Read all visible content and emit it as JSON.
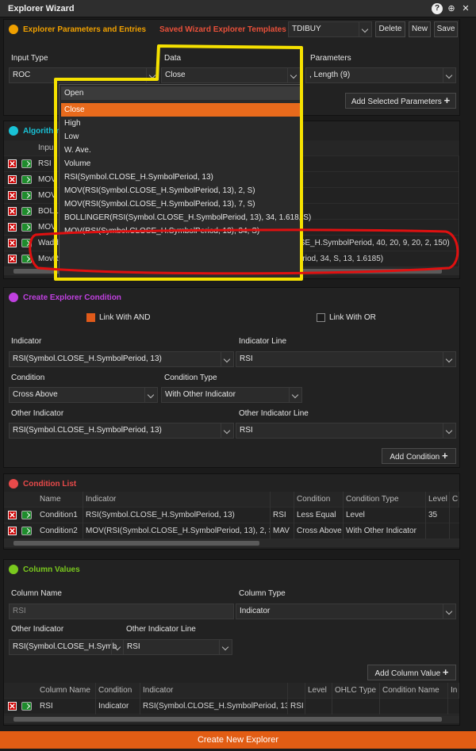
{
  "window": {
    "title": "Explorer Wizard",
    "help": "?",
    "pin": "⊕",
    "close": "✕"
  },
  "params": {
    "title": "Explorer Parameters and Entries",
    "templates_label": "Saved Wizard Explorer Templates",
    "template_value": "TDIBUY",
    "delete": "Delete",
    "new": "New",
    "save": "Save",
    "input_type_label": "Input Type",
    "input_type_value": "ROC",
    "data_label": "Data",
    "data_value": "Close",
    "parameters_label": "Parameters",
    "parameters_value": ", Length (9)",
    "add_selected": "Add Selected Parameters",
    "dropdown_items": [
      "Open",
      "Close",
      "High",
      "Low",
      "W. Ave.",
      "Volume",
      "RSI(Symbol.CLOSE_H.SymbolPeriod, 13)",
      "MOV(RSI(Symbol.CLOSE_H.SymbolPeriod, 13), 2, S)",
      "MOV(RSI(Symbol.CLOSE_H.SymbolPeriod, 13), 7, S)",
      "BOLLINGER(RSI(Symbol.CLOSE_H.SymbolPeriod, 13), 34, 1.618, S)",
      "MOV(RSI(Symbol.CLOSE_H.SymbolPeriod, 13), 34, S)"
    ]
  },
  "algorithms": {
    "title": "Algorithm",
    "header_input": "Inpu",
    "rows": [
      {
        "name": "RSI",
        "value": ""
      },
      {
        "name": "MOV",
        "value": "), 2, S)"
      },
      {
        "name": "MOV",
        "value": "), 7, S)"
      },
      {
        "name": "BOLL",
        "value": "13), 34, 1.618, S)"
      },
      {
        "name": "MOV",
        "value": "), 34, S)"
      },
      {
        "name": "WaddahAttarExplosionKripex",
        "value": "WaddahAttarExplosionKripex(Symbol.CLOSE_H.SymbolPeriod, 40, 20, 9, 20, 2, 150)"
      },
      {
        "name": "MovRsiStdev",
        "value": "MovRsiStdev(Symbol.CLOSE_H.SymbolPeriod, 34, S, 13, 1.6185)"
      }
    ]
  },
  "condition": {
    "title": "Create Explorer Condition",
    "link_and": "Link With AND",
    "link_or": "Link With OR",
    "indicator_label": "Indicator",
    "indicator_value": "RSI(Symbol.CLOSE_H.SymbolPeriod, 13)",
    "indicator_line_label": "Indicator Line",
    "indicator_line_value": "RSI",
    "condition_label": "Condition",
    "condition_value": "Cross Above",
    "condition_type_label": "Condition Type",
    "condition_type_value": "With Other Indicator",
    "other_indicator_label": "Other Indicator",
    "other_indicator_value": "RSI(Symbol.CLOSE_H.SymbolPeriod, 13)",
    "other_line_label": "Other Indicator Line",
    "other_line_value": "RSI",
    "add_condition": "Add Condition"
  },
  "condition_list": {
    "title": "Condition List",
    "headers": [
      "Name",
      "Indicator",
      "",
      "Condition",
      "Condition Type",
      "Level",
      "C"
    ],
    "rows": [
      [
        "Condition1",
        "RSI(Symbol.CLOSE_H.SymbolPeriod, 13)",
        "RSI",
        "Less Equal",
        "Level",
        "35"
      ],
      [
        "Condition2",
        "MOV(RSI(Symbol.CLOSE_H.SymbolPeriod, 13), 2, S)",
        "MAV",
        "Cross Above",
        "With Other Indicator",
        ""
      ]
    ]
  },
  "column_values": {
    "title": "Column Values",
    "column_name_label": "Column Name",
    "column_name_value": "RSI",
    "column_type_label": "Column Type",
    "column_type_value": "Indicator",
    "other_indicator_label": "Other Indicator",
    "other_indicator_value": "RSI(Symbol.CLOSE_H.Symb",
    "other_line_label": "Other Indicator Line",
    "other_line_value": "RSI",
    "add_column": "Add Column Value",
    "headers": [
      "Column Name",
      "Condition",
      "Indicator",
      "",
      "Level",
      "OHLC Type",
      "Condition Name",
      "In"
    ],
    "row": [
      "RSI",
      "Indicator",
      "RSI(Symbol.CLOSE_H.SymbolPeriod, 13)",
      "RSI",
      "",
      "",
      "",
      ""
    ]
  },
  "footer": {
    "create": "Create New Explorer"
  },
  "colors": {
    "accent": "#e25d14",
    "params_dot": "#f0a000",
    "algo_dot": "#19c2d6",
    "cond_dot": "#c040e0",
    "list_dot": "#e84a4a",
    "col_dot": "#7ac91e",
    "yellow_box": "#f5e100",
    "red_box": "#e01010"
  }
}
